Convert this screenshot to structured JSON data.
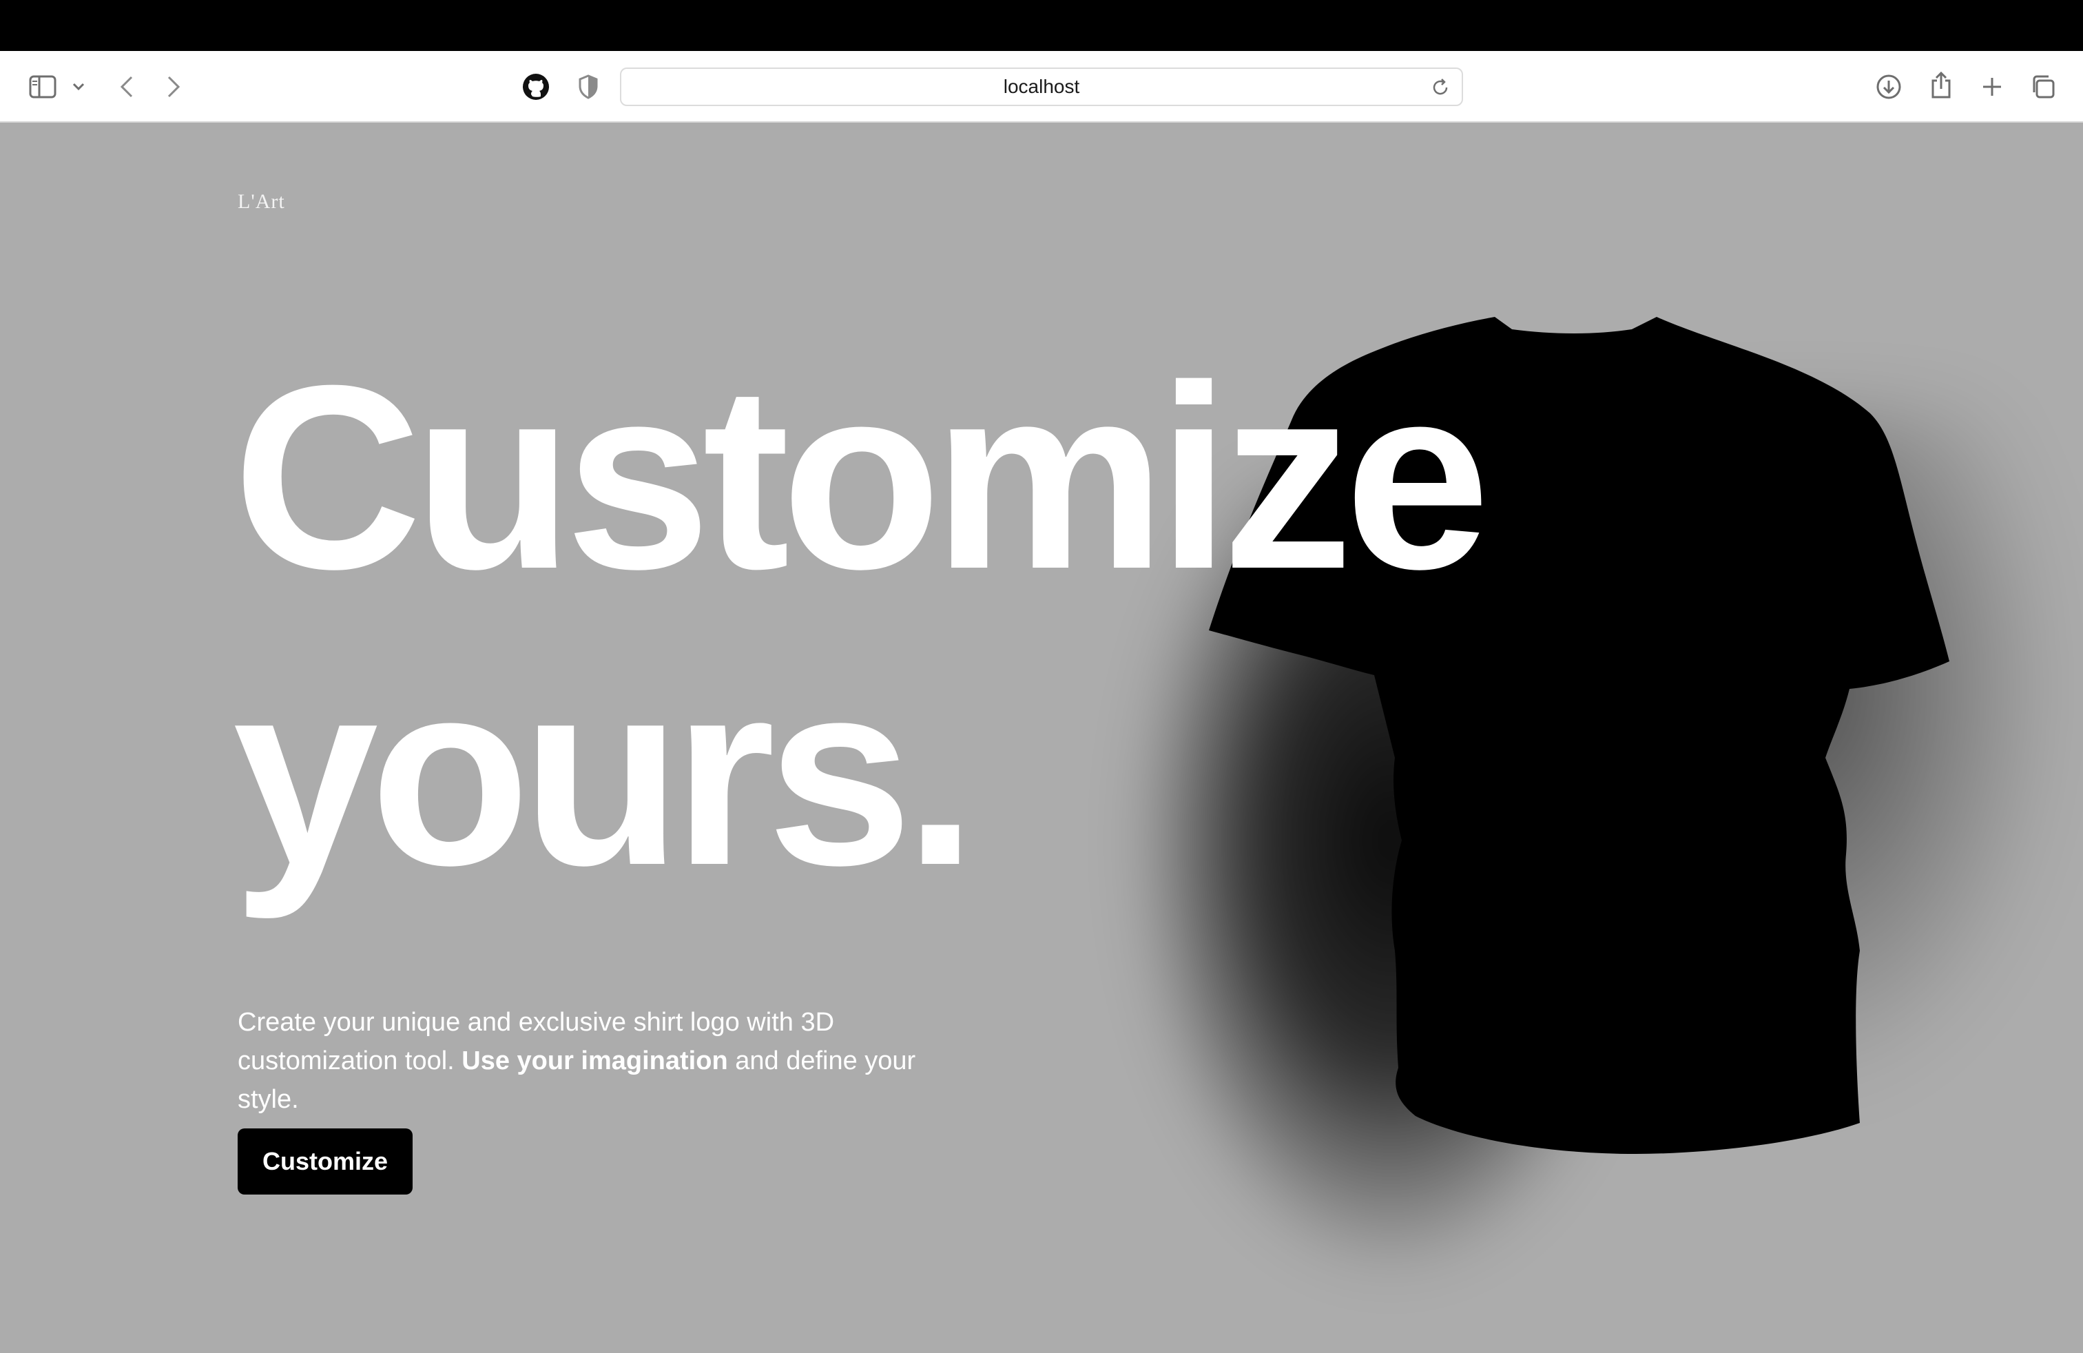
{
  "browser": {
    "url": "localhost",
    "icons": {
      "sidebar": "sidebar-icon",
      "chevron": "chevron-down-icon",
      "back": "back-arrow-icon",
      "forward": "forward-arrow-icon",
      "github": "github-icon",
      "shield": "privacy-shield-icon",
      "reload": "reload-icon",
      "download": "download-icon",
      "share": "share-icon",
      "new_tab": "plus-icon",
      "tabs": "tab-overview-icon"
    }
  },
  "page": {
    "brand": "L'Art",
    "headline_line1": "Customize",
    "headline_line2": "yours.",
    "subtitle_part1": "Create your unique and exclusive shirt logo with 3D customization tool. ",
    "subtitle_bold": "Use your imagination",
    "subtitle_part2": " and define your style.",
    "cta_label": "Customize",
    "colors": {
      "background": "#acacac",
      "text": "#ffffff",
      "button": "#000000",
      "shirt": "#000000"
    }
  }
}
